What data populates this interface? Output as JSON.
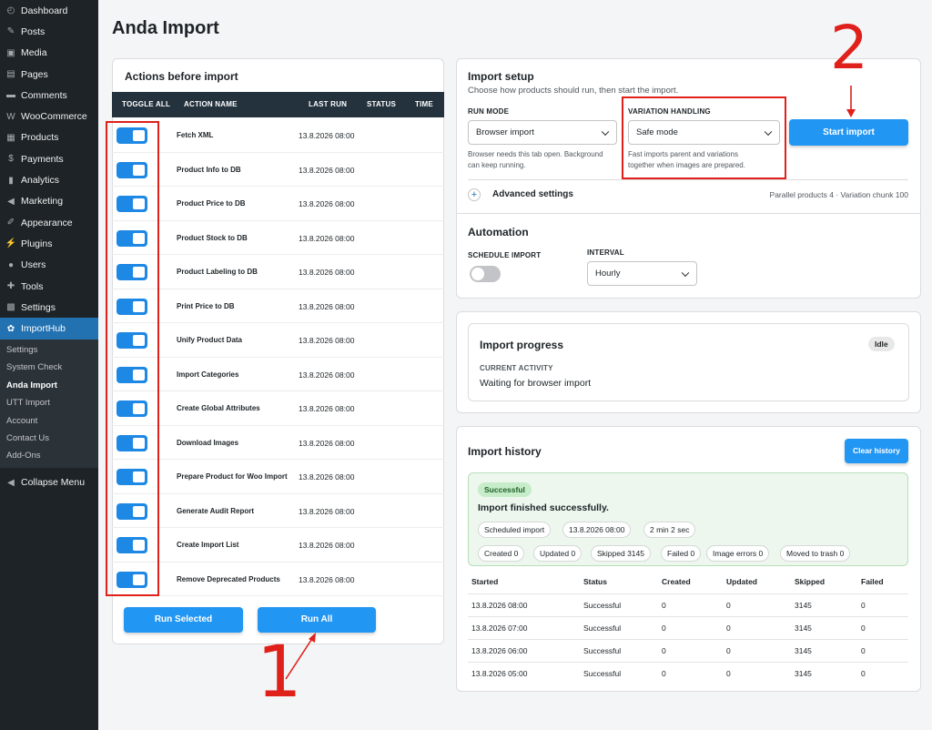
{
  "sidebar": {
    "items": [
      {
        "label": "Dashboard",
        "icon": "dashboard-icon",
        "glyph": "◴"
      },
      {
        "label": "Posts",
        "icon": "pin-icon",
        "glyph": "✎"
      },
      {
        "label": "Media",
        "icon": "media-icon",
        "glyph": "▣"
      },
      {
        "label": "Pages",
        "icon": "pages-icon",
        "glyph": "▤"
      },
      {
        "label": "Comments",
        "icon": "comments-icon",
        "glyph": "▬"
      },
      {
        "label": "WooCommerce",
        "icon": "woo-icon",
        "glyph": "W"
      },
      {
        "label": "Products",
        "icon": "products-icon",
        "glyph": "▦"
      },
      {
        "label": "Payments",
        "icon": "payments-icon",
        "glyph": "$"
      },
      {
        "label": "Analytics",
        "icon": "analytics-icon",
        "glyph": "▮"
      },
      {
        "label": "Marketing",
        "icon": "megaphone-icon",
        "glyph": "◀"
      },
      {
        "label": "Appearance",
        "icon": "brush-icon",
        "glyph": "✐"
      },
      {
        "label": "Plugins",
        "icon": "plugin-icon",
        "glyph": "⚡"
      },
      {
        "label": "Users",
        "icon": "user-icon",
        "glyph": "●"
      },
      {
        "label": "Tools",
        "icon": "wrench-icon",
        "glyph": "✚"
      },
      {
        "label": "Settings",
        "icon": "settings-icon",
        "glyph": "▩"
      },
      {
        "label": "ImportHub",
        "icon": "importhub-icon",
        "glyph": "✿"
      }
    ],
    "submenu": [
      "Settings",
      "System Check",
      "Anda Import",
      "UTT Import",
      "Account",
      "Contact Us",
      "Add-Ons"
    ],
    "collapse_label": "Collapse Menu"
  },
  "page_title": "Anda Import",
  "actions": {
    "title": "Actions before import",
    "headers": {
      "toggle": "TOGGLE ALL",
      "name": "ACTION NAME",
      "last_run": "LAST RUN",
      "status": "STATUS",
      "time": "TIME"
    },
    "rows": [
      {
        "name": "Fetch XML",
        "last_run": "13.8.2026 08:00"
      },
      {
        "name": "Product Info to DB",
        "last_run": "13.8.2026 08:00"
      },
      {
        "name": "Product Price to DB",
        "last_run": "13.8.2026 08:00"
      },
      {
        "name": "Product Stock to DB",
        "last_run": "13.8.2026 08:00"
      },
      {
        "name": "Product Labeling to DB",
        "last_run": "13.8.2026 08:00"
      },
      {
        "name": "Print Price to DB",
        "last_run": "13.8.2026 08:00"
      },
      {
        "name": "Unify Product Data",
        "last_run": "13.8.2026 08:00"
      },
      {
        "name": "Import Categories",
        "last_run": "13.8.2026 08:00"
      },
      {
        "name": "Create Global Attributes",
        "last_run": "13.8.2026 08:00"
      },
      {
        "name": "Download Images",
        "last_run": "13.8.2026 08:00"
      },
      {
        "name": "Prepare Product for Woo Import",
        "last_run": "13.8.2026 08:00"
      },
      {
        "name": "Generate Audit Report",
        "last_run": "13.8.2026 08:00"
      },
      {
        "name": "Create Import List",
        "last_run": "13.8.2026 08:00"
      },
      {
        "name": "Remove Deprecated Products",
        "last_run": "13.8.2026 08:00"
      }
    ],
    "run_selected": "Run Selected",
    "run_all": "Run All"
  },
  "annotations": {
    "one": "1",
    "two": "2"
  },
  "setup": {
    "title": "Import setup",
    "subtitle": "Choose how products should run, then start the import.",
    "run_mode_label": "RUN MODE",
    "run_mode_value": "Browser import",
    "run_mode_hint_1": "Browser needs this tab open. Background",
    "run_mode_hint_2": "can keep running.",
    "variation_label": "VARIATION HANDLING",
    "variation_value": "Safe mode",
    "variation_hint_1": "Fast imports parent and variations",
    "variation_hint_2": "together when images are prepared.",
    "start_button": "Start import",
    "advanced_label": "Advanced settings",
    "advanced_summary": "Parallel products 4 · Variation chunk 100",
    "automation_title": "Automation",
    "schedule_label": "SCHEDULE IMPORT",
    "interval_label": "INTERVAL",
    "interval_value": "Hourly"
  },
  "progress": {
    "title": "Import progress",
    "badge": "Idle",
    "activity_label": "CURRENT ACTIVITY",
    "activity_value": "Waiting for browser import"
  },
  "history": {
    "title": "Import history",
    "clear_button": "Clear history",
    "latest": {
      "badge": "Successful",
      "message": "Import finished successfully.",
      "pills_1": [
        "Scheduled import",
        "13.8.2026 08:00",
        "2 min 2 sec"
      ],
      "pills_2": [
        "Created 0",
        "Updated 0",
        "Skipped 3145",
        "Failed 0",
        "Image errors 0",
        "Moved to trash 0"
      ]
    },
    "headers": [
      "Started",
      "Status",
      "Created",
      "Updated",
      "Skipped",
      "Failed"
    ],
    "rows": [
      [
        "13.8.2026 08:00",
        "Successful",
        "0",
        "0",
        "3145",
        "0"
      ],
      [
        "13.8.2026 07:00",
        "Successful",
        "0",
        "0",
        "3145",
        "0"
      ],
      [
        "13.8.2026 06:00",
        "Successful",
        "0",
        "0",
        "3145",
        "0"
      ],
      [
        "13.8.2026 05:00",
        "Successful",
        "0",
        "0",
        "3145",
        "0"
      ]
    ]
  },
  "colors": {
    "primary": "#2196f3",
    "sidebar": "#1d2327",
    "active": "#2271b1",
    "annotation": "#e0201a",
    "table_header": "#24323e"
  }
}
